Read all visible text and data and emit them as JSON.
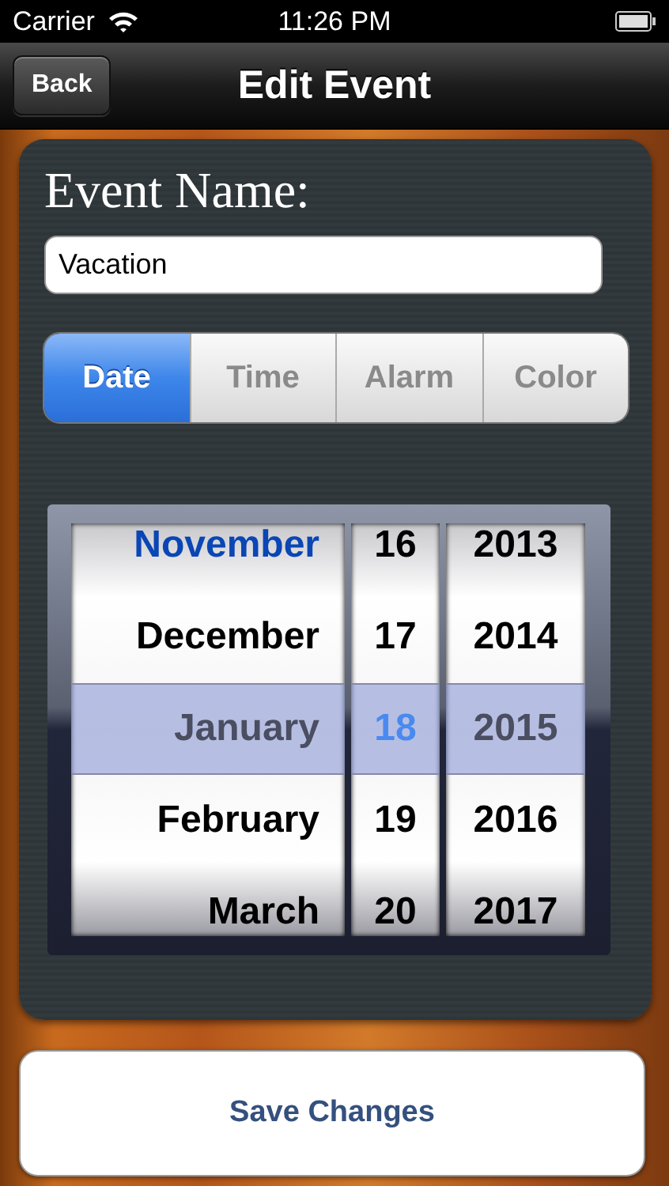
{
  "status_bar": {
    "carrier": "Carrier",
    "time": "11:26 PM"
  },
  "nav_bar": {
    "back": "Back",
    "title": "Edit Event"
  },
  "event_name": {
    "label": "Event Name:",
    "value": "Vacation"
  },
  "tabs": [
    {
      "label": "Date",
      "selected": true
    },
    {
      "label": "Time",
      "selected": false
    },
    {
      "label": "Alarm",
      "selected": false
    },
    {
      "label": "Color",
      "selected": false
    }
  ],
  "picker": {
    "columns": [
      {
        "items": [
          {
            "label": "November",
            "selected": false,
            "today": true
          },
          {
            "label": "December",
            "selected": false,
            "today": false
          },
          {
            "label": "January",
            "selected": true,
            "today": false
          },
          {
            "label": "February",
            "selected": false,
            "today": false
          },
          {
            "label": "March",
            "selected": false,
            "today": false
          }
        ]
      },
      {
        "items": [
          {
            "label": "16",
            "selected": false,
            "today": false
          },
          {
            "label": "17",
            "selected": false,
            "today": false
          },
          {
            "label": "18",
            "selected": true,
            "today": true
          },
          {
            "label": "19",
            "selected": false,
            "today": false
          },
          {
            "label": "20",
            "selected": false,
            "today": false
          }
        ]
      },
      {
        "items": [
          {
            "label": "2013",
            "selected": false,
            "today": false
          },
          {
            "label": "2014",
            "selected": false,
            "today": false
          },
          {
            "label": "2015",
            "selected": true,
            "today": false
          },
          {
            "label": "2016",
            "selected": false,
            "today": false
          },
          {
            "label": "2017",
            "selected": false,
            "today": false
          }
        ]
      }
    ]
  },
  "save_button": "Save Changes"
}
